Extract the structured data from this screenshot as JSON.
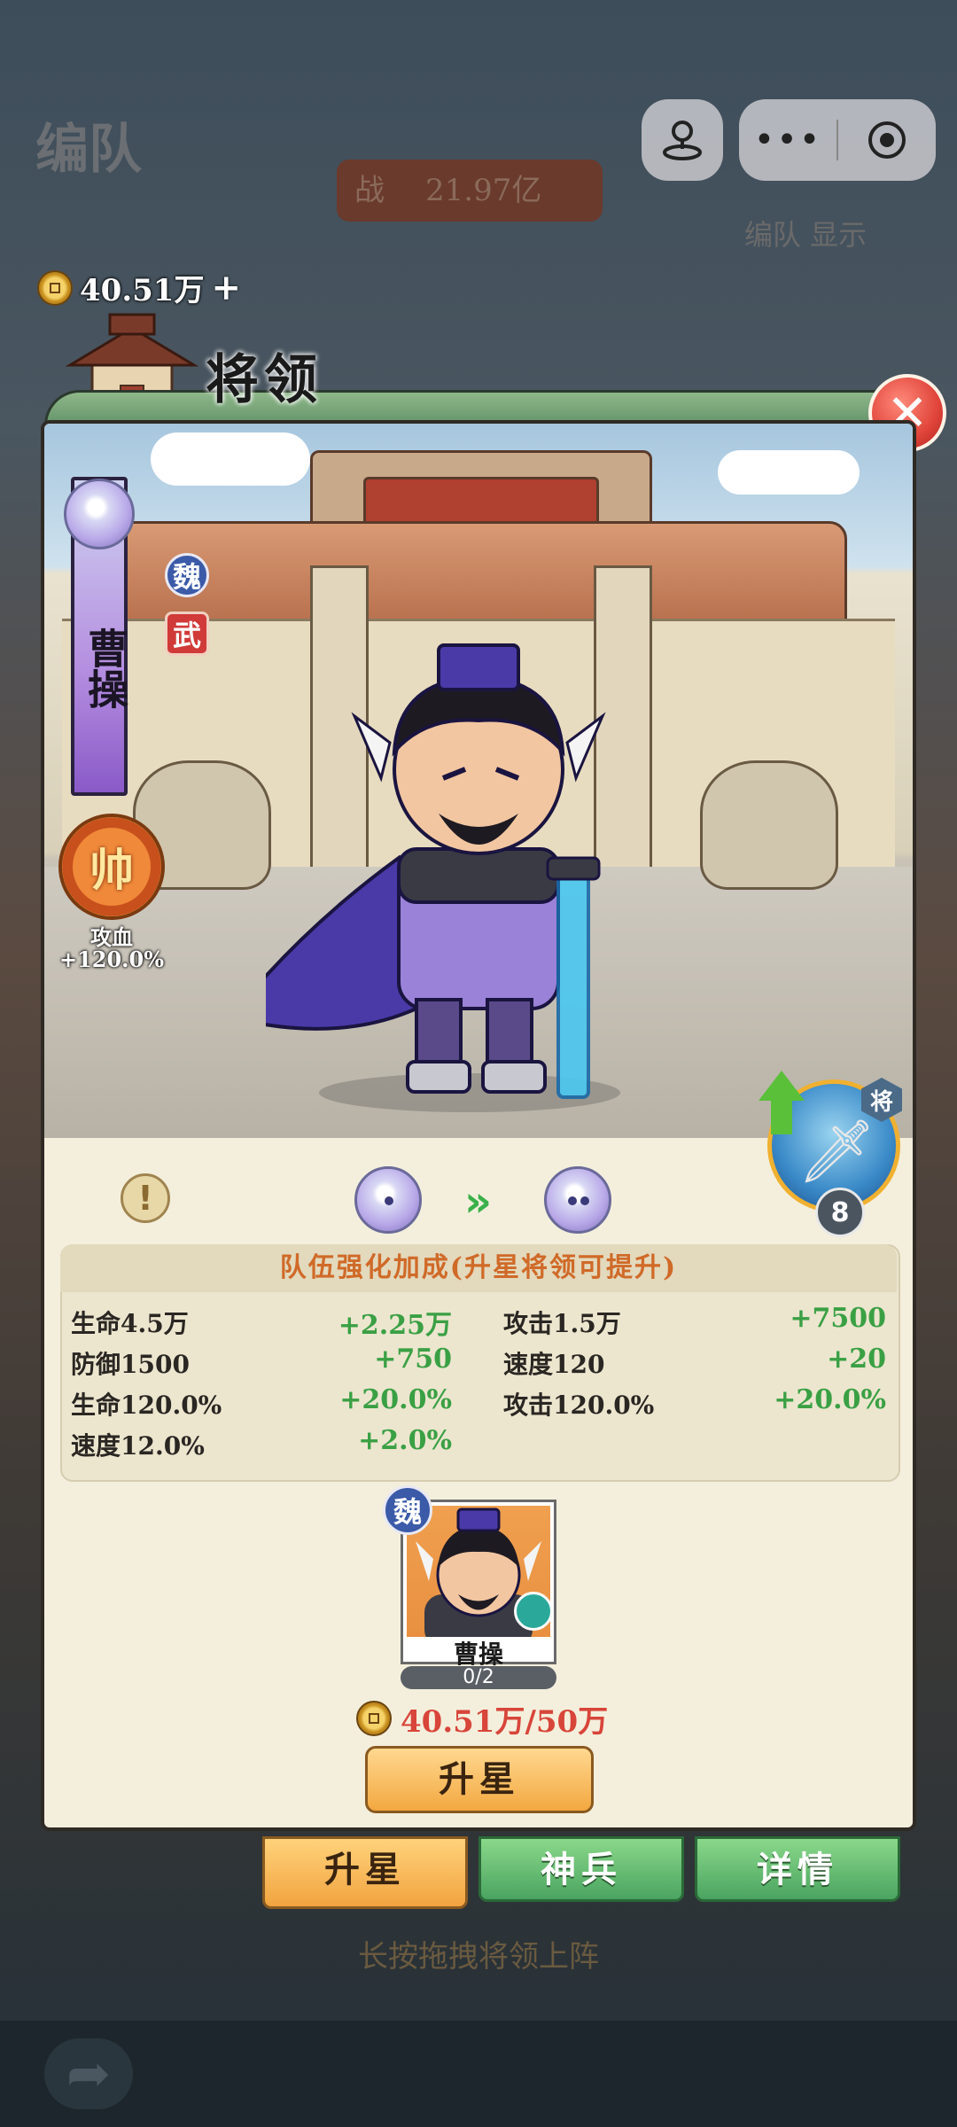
{
  "background": {
    "title": "编队",
    "power_label": "战",
    "power_value": "21.97亿",
    "right_label": "编队 显示",
    "bottom_hint": "长按拖拽将领上阵"
  },
  "currency": {
    "amount": "40.51万",
    "plus": "+"
  },
  "panel": {
    "title": "将领"
  },
  "hero": {
    "name": "曹操",
    "faction": "魏",
    "role": "武",
    "marshal_badge": "帅",
    "marshal_label": "攻血",
    "marshal_value": "+120.0%"
  },
  "skill": {
    "tag": "将",
    "level": "8"
  },
  "bonus": {
    "title": "队伍强化加成(升星将领可提升)",
    "stats": [
      {
        "label": "生命4.5万",
        "bonus": "+2.25万"
      },
      {
        "label": "攻击1.5万",
        "bonus": "+7500"
      },
      {
        "label": "防御1500",
        "bonus": "+750"
      },
      {
        "label": "速度120",
        "bonus": "+20"
      },
      {
        "label": "生命120.0%",
        "bonus": "+20.0%"
      },
      {
        "label": "攻击120.0%",
        "bonus": "+20.0%"
      },
      {
        "label": "速度12.0%",
        "bonus": "+2.0%"
      }
    ]
  },
  "material": {
    "faction": "魏",
    "name": "曹操",
    "count": "0/2"
  },
  "cost": {
    "text": "40.51万/50万"
  },
  "buttons": {
    "upgrade": "升星"
  },
  "tabs": {
    "star": "升星",
    "weapon": "神兵",
    "detail": "详情"
  },
  "colors": {
    "bonus_green": "#3aa044",
    "cost_red": "#d8453a",
    "title_orange": "#d06a28"
  }
}
